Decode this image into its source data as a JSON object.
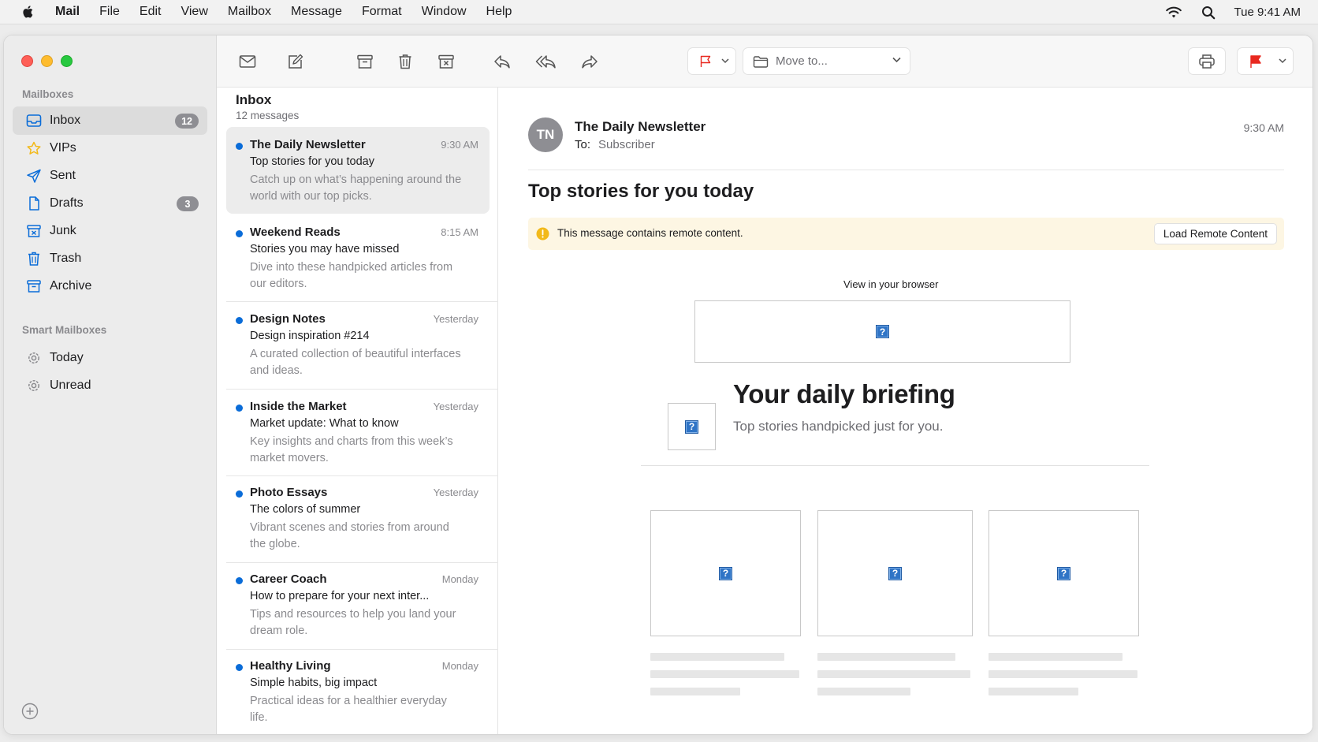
{
  "menubar": {
    "app": "Mail",
    "items": [
      "File",
      "Edit",
      "View",
      "Mailbox",
      "Message",
      "Format",
      "Window",
      "Help"
    ],
    "clock": "Tue 9:41 AM"
  },
  "sidebar": {
    "mailboxes_header": "Mailboxes",
    "items": [
      {
        "label": "Inbox",
        "icon": "inbox-icon",
        "badge": "12"
      },
      {
        "label": "VIPs",
        "icon": "star-icon"
      },
      {
        "label": "Sent",
        "icon": "paperplane-icon"
      },
      {
        "label": "Drafts",
        "icon": "document-icon",
        "badge": "3"
      },
      {
        "label": "Junk",
        "icon": "junk-icon"
      },
      {
        "label": "Trash",
        "icon": "trash-icon"
      },
      {
        "label": "Archive",
        "icon": "archive-icon"
      }
    ],
    "smart_header": "Smart Mailboxes",
    "smart_items": [
      {
        "label": "Today",
        "icon": "gear-icon"
      },
      {
        "label": "Unread",
        "icon": "gear-icon"
      }
    ]
  },
  "toolbar": {
    "move_to": "Move to..."
  },
  "list": {
    "title": "Inbox",
    "count": "12 messages",
    "messages": [
      {
        "sender": "The Daily Newsletter",
        "time": "9:30 AM",
        "subject": "Top stories for you today",
        "preview": "Catch up on what’s happening around the world with our top picks."
      },
      {
        "sender": "Weekend Reads",
        "time": "8:15 AM",
        "subject": "Stories you may have missed",
        "preview": "Dive into these handpicked articles from our editors."
      },
      {
        "sender": "Design Notes",
        "time": "Yesterday",
        "subject": "Design inspiration #214",
        "preview": "A curated collection of beautiful interfaces and ideas."
      },
      {
        "sender": "Inside the Market",
        "time": "Yesterday",
        "subject": "Market update: What to know",
        "preview": "Key insights and charts from this week’s market movers."
      },
      {
        "sender": "Photo Essays",
        "time": "Yesterday",
        "subject": "The colors of summer",
        "preview": "Vibrant scenes and stories from around the globe."
      },
      {
        "sender": "Career Coach",
        "time": "Monday",
        "subject": "How to prepare for your next inter...",
        "preview": "Tips and resources to help you land your dream role."
      },
      {
        "sender": "Healthy Living",
        "time": "Monday",
        "subject": "Simple habits, big impact",
        "preview": "Practical ideas for a healthier everyday life."
      }
    ]
  },
  "message": {
    "avatar": "TN",
    "from": "The Daily Newsletter",
    "to_label": "To:",
    "to": "Subscriber",
    "time": "9:30 AM",
    "subject": "Top stories for you today",
    "remote_notice": "This message contains remote content.",
    "load_remote": "Load Remote Content",
    "view_in_browser": "View in your browser",
    "briefing_title": "Your daily briefing",
    "briefing_sub": "Top stories handpicked just for you.",
    "broken_image_glyph": "?"
  },
  "colors": {
    "accent": "#0a6cd8",
    "flag_red": "#e8281f",
    "warning": "#f2b91a",
    "remote_bg": "#fdf6e3"
  }
}
